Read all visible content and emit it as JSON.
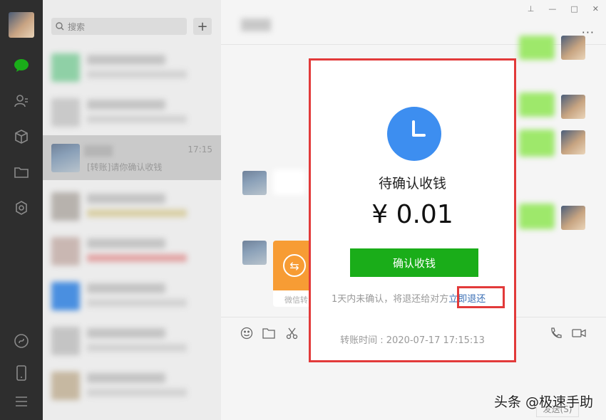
{
  "search": {
    "placeholder": "搜索",
    "add": "+"
  },
  "active_chat": {
    "time": "17:15",
    "preview": "[转账]请你确认收钱"
  },
  "dialog": {
    "status": "待确认收钱",
    "amount": "¥ 0.01",
    "confirm_button": "确认收钱",
    "note": "1天内未确认，将退还给对方",
    "return_link": "立即退还",
    "time_label": "转账时间 : 2020-07-17 17:15:13"
  },
  "transfer_card_label": "微信转",
  "send_button": "发送(S)",
  "watermark": "头条 @极速手助",
  "colors": {
    "accent_green": "#1aad19",
    "clock_blue": "#3d8ef0",
    "highlight_red": "#e23a3a",
    "link_blue": "#3b6fb5"
  }
}
